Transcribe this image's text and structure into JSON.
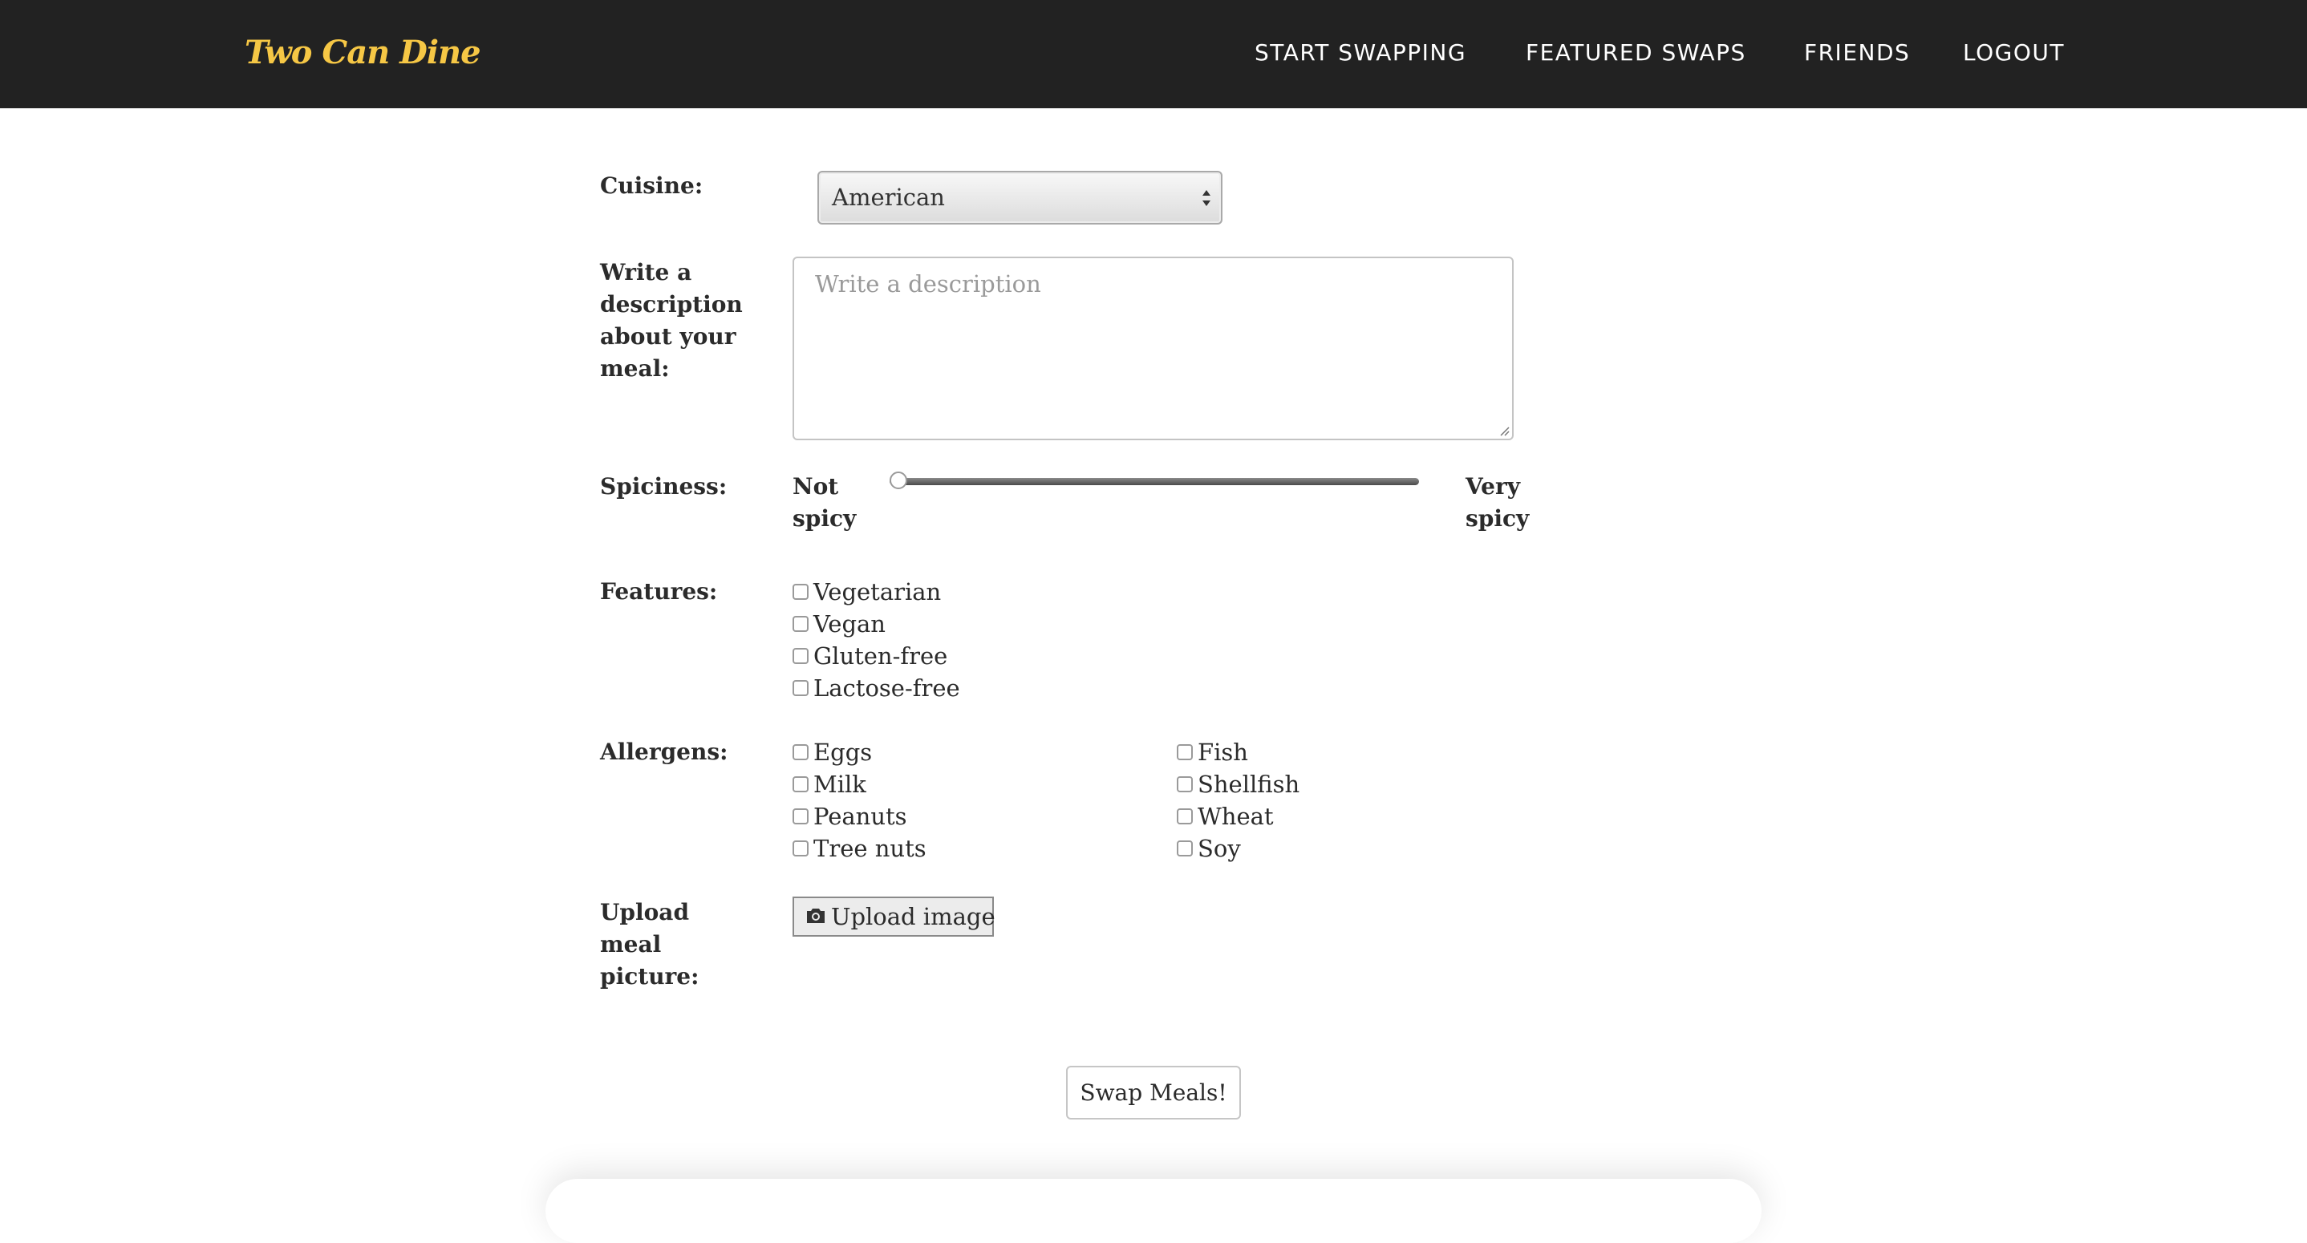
{
  "nav": {
    "brand": "Two Can Dine",
    "links": [
      "START SWAPPING",
      "FEATURED SWAPS",
      "FRIENDS",
      "LOGOUT"
    ]
  },
  "form": {
    "cuisine": {
      "label": "Cuisine:",
      "selected": "American"
    },
    "description": {
      "label": "Write a description about your meal:",
      "placeholder": "Write a description",
      "value": ""
    },
    "spiciness": {
      "label": "Spiciness:",
      "min_label": "Not spicy",
      "max_label": "Very spicy",
      "level": 0
    },
    "features": {
      "label": "Features:",
      "options": [
        "Vegetarian",
        "Vegan",
        "Gluten-free",
        "Lactose-free"
      ]
    },
    "allergens": {
      "label": "Allergens:",
      "options": [
        "Eggs",
        "Milk",
        "Peanuts",
        "Tree nuts",
        "Fish",
        "Shellfish",
        "Wheat",
        "Soy"
      ]
    },
    "upload": {
      "label": "Upload meal picture:",
      "button": "Upload image"
    },
    "submit": "Swap Meals!"
  },
  "colors": {
    "navbar": "#222222",
    "brand": "#f6c745"
  }
}
